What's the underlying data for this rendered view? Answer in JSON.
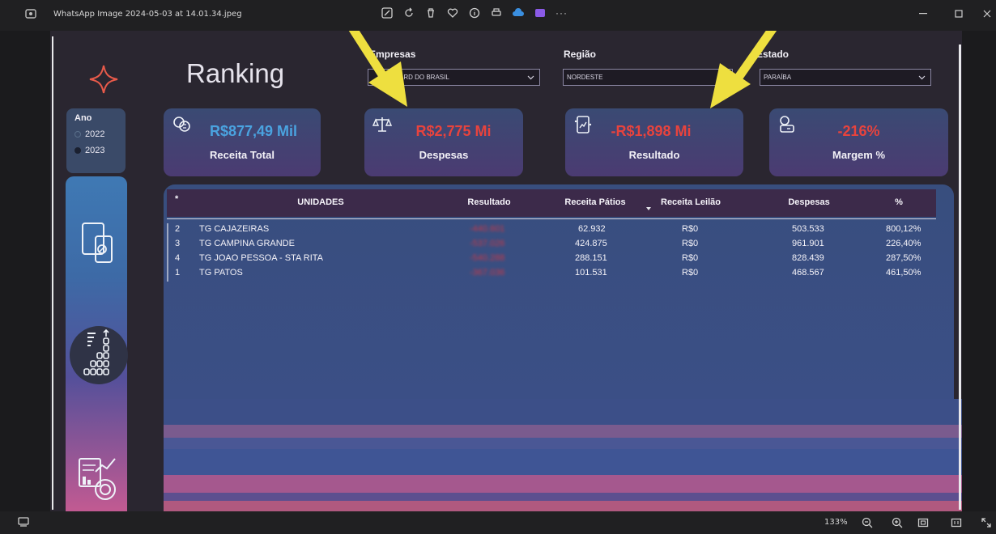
{
  "viewer": {
    "filename": "WhatsApp Image 2024-05-03 at 14.01.34.jpeg",
    "more_label": "···",
    "zoom_label": "133%"
  },
  "report": {
    "title": "Ranking",
    "filters": {
      "empresas": {
        "label": "Empresas",
        "value": "GUARD DO BRASIL"
      },
      "regiao": {
        "label": "Região",
        "value": "NORDESTE"
      },
      "estado": {
        "label": "Estado",
        "value": "PARAÍBA"
      }
    },
    "year_slicer": {
      "title": "Ano",
      "options": [
        {
          "label": "2022",
          "selected": false
        },
        {
          "label": "2023",
          "selected": true
        }
      ]
    },
    "kpis": [
      {
        "value": "R$877,49 Mil",
        "label": "Receita Total",
        "color": "#4aa3e0",
        "icon": "money-bag-icon"
      },
      {
        "value": "R$2,775 Mi",
        "label": "Despesas",
        "color": "#e8433d",
        "icon": "scale-icon"
      },
      {
        "value": "-R$1,898 Mi",
        "label": "Resultado",
        "color": "#e8433d",
        "icon": "device-chart-icon"
      },
      {
        "value": "-216%",
        "label": "Margem %",
        "color": "#e8433d",
        "icon": "coins-icon"
      }
    ],
    "table": {
      "columns": [
        "*",
        "UNIDADES",
        "Resultado",
        "Receita Pátios",
        "Receita Leilão",
        "Despesas",
        "%"
      ],
      "rows": [
        {
          "rank": "2",
          "unit": "TG CAJAZEIRAS",
          "resultado": "-440.601",
          "patios": "62.932",
          "leilao": "R$0",
          "despesas": "503.533",
          "pct": "800,12%"
        },
        {
          "rank": "3",
          "unit": "TG CAMPINA GRANDE",
          "resultado": "-537.026",
          "patios": "424.875",
          "leilao": "R$0",
          "despesas": "961.901",
          "pct": "226,40%"
        },
        {
          "rank": "4",
          "unit": "TG JOAO PESSOA - STA RITA",
          "resultado": "-540.288",
          "patios": "288.151",
          "leilao": "R$0",
          "despesas": "828.439",
          "pct": "287,50%"
        },
        {
          "rank": "1",
          "unit": "TG PATOS",
          "resultado": "-367.036",
          "patios": "101.531",
          "leilao": "R$0",
          "despesas": "468.567",
          "pct": "461,50%"
        }
      ]
    },
    "colors": {
      "accent_blue": "#4aa3e0",
      "negative_red": "#e8433d",
      "annotation_yellow": "#eedf3f"
    }
  }
}
